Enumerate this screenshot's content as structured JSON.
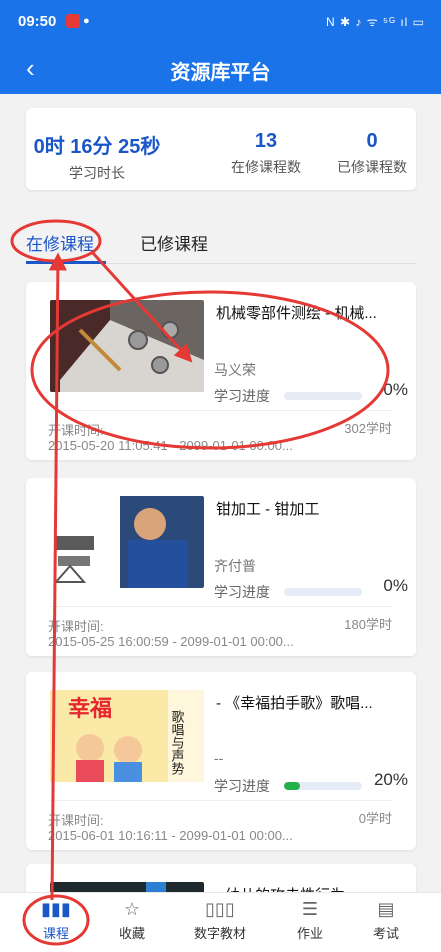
{
  "status_bar": {
    "time": "09:50",
    "indicators": "N ✱ ♪ ᯤ ⁵ᴳ ıl ▭"
  },
  "app_bar": {
    "back_icon": "chevron-left-icon",
    "title": "资源库平台"
  },
  "stats": [
    {
      "value": "0时 16分 25秒",
      "label": "学习时长"
    },
    {
      "value": "13",
      "label": "在修课程数"
    },
    {
      "value": "0",
      "label": "已修课程数"
    }
  ],
  "tabs": {
    "active": "在修课程",
    "inactive": "已修课程"
  },
  "courses": [
    {
      "title": "机械零部件测绘 - 机械...",
      "teacher": "马义荣",
      "progress_label": "学习进度",
      "progress_value": "0%",
      "progress_fraction": 0.0,
      "open_label": "开课时间:",
      "open_range": "2015-05-20 11:05:41 - 2099-01-01 00:00...",
      "hours": "302学时"
    },
    {
      "title": "钳加工 - 钳加工",
      "teacher": "齐付普",
      "progress_label": "学习进度",
      "progress_value": "0%",
      "progress_fraction": 0.0,
      "open_label": "开课时间:",
      "open_range": "2015-05-25 16:00:59 - 2099-01-01 00:00...",
      "hours": "180学时"
    },
    {
      "title": "- 《幸福拍手歌》歌唱...",
      "teacher": "--",
      "progress_label": "学习进度",
      "progress_value": "20%",
      "progress_fraction": 0.2,
      "open_label": "开课时间:",
      "open_range": "2015-06-01 10:16:11 - 2099-01-01 00:00...",
      "hours": "0学时",
      "thumb_text": {
        "big": "幸福",
        "side": "歌唱与声势"
      }
    },
    {
      "title": "- 幼儿的攻击性行为"
    }
  ],
  "bottom_nav": [
    {
      "label": "课程",
      "icon": "books-icon",
      "active": true
    },
    {
      "label": "收藏",
      "icon": "star-icon",
      "active": false
    },
    {
      "label": "数字教材",
      "icon": "bookshelf-icon",
      "active": false
    },
    {
      "label": "作业",
      "icon": "homework-icon",
      "active": false
    },
    {
      "label": "考试",
      "icon": "exam-icon",
      "active": false
    }
  ],
  "colors": {
    "primary": "#1a73e8",
    "accent_text": "#1a56c8",
    "progress": "#22b24c",
    "annotation": "#e53935"
  }
}
